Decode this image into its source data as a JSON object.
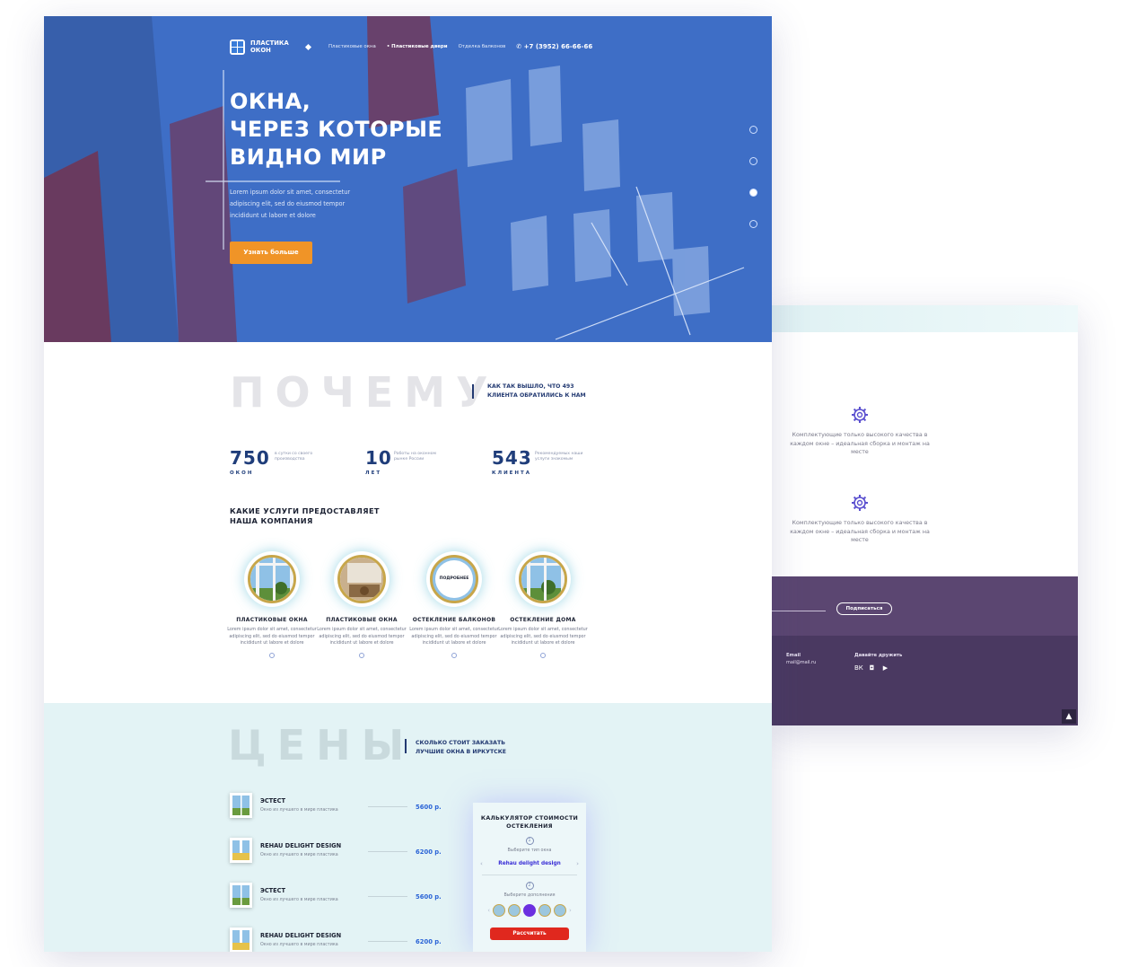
{
  "back_page": {
    "features": [
      {
        "text": "Комплектующие только высокого качества в каждом окне – идеальная сборка и монтаж на месте"
      },
      {
        "text": "Комплектующие только высокого качества в каждом окне – идеальная сборка и монтаж на месте"
      }
    ],
    "subscribe_label": "Подписаться",
    "footer": {
      "email_title": "Email",
      "email_value": "mail@mail.ru",
      "social_title": "Давайте дружить",
      "social_icons": [
        "vk-icon",
        "instagram-icon",
        "youtube-icon"
      ]
    }
  },
  "header": {
    "logo_line1": "ПЛАСТИКА",
    "logo_line2": "ОКОН",
    "nav": [
      "Пластиковые окна",
      "• Пластиковые двери",
      "Отделка балконов"
    ],
    "phone": "+7 (3952) 66-66-66"
  },
  "hero": {
    "title_lines": [
      "ОКНА,",
      "ЧЕРЕЗ КОТОРЫЕ",
      "ВИДНО МИР"
    ],
    "text": "Lorem ipsum dolor sit amet, consectetur adipiscing elit, sed do eiusmod tempor incididunt ut labore et dolore",
    "button": "Узнать больше",
    "slider_active": 3,
    "slider_total": 4
  },
  "why": {
    "heading": "ПОЧЕМУ",
    "subtitle": "КАК ТАК ВЫШЛО, ЧТО 493 КЛИЕНТА ОБРАТИЛИСЬ К НАМ",
    "stats": [
      {
        "number": "750",
        "label": "ОКОН",
        "desc": "в сутки со своего производства"
      },
      {
        "number": "10",
        "label": "ЛЕТ",
        "desc": "Работы на оконном рынке России"
      },
      {
        "number": "543",
        "label": "КЛИЕНТА",
        "desc": "Рекомендуемых наши услуги знакомым"
      }
    ]
  },
  "services": {
    "title": "КАКИЕ УСЛУГИ ПРЕДОСТАВЛЯЕТ НАША КОМПАНИЯ",
    "items": [
      {
        "title": "ПЛАСТИКОВЫЕ ОКНА",
        "text": "Lorem ipsum dolor sit amet, consectetur adipiscing elit, sed do eiusmod tempor incididunt ut labore et dolore"
      },
      {
        "title": "ПЛАСТИКОВЫЕ ОКНА",
        "text": "Lorem ipsum dolor sit amet, consectetur adipiscing elit, sed do eiusmod tempor incididunt ut labore et dolore"
      },
      {
        "title": "ОСТЕКЛЕНИЕ БАЛКОНОВ",
        "text": "Lorem ipsum dolor sit amet, consectetur adipiscing elit, sed do eiusmod tempor incididunt ut labore et dolore",
        "badge": "ПОДРОБНЕЕ"
      },
      {
        "title": "ОСТЕКЛЕНИЕ ДОМА",
        "text": "Lorem ipsum dolor sit amet, consectetur adipiscing elit, sed do eiusmod tempor incididunt ut labore et dolore"
      }
    ]
  },
  "prices": {
    "heading": "ЦЕНЫ",
    "subtitle": "СКОЛЬКО СТОИТ ЗАКАЗАТЬ ЛУЧШИЕ ОКНА В ИРКУТСКЕ",
    "rows": [
      {
        "name": "ЭСТЕСТ",
        "desc": "Окно из лучшего в мире пластика",
        "price": "5600 р."
      },
      {
        "name": "REHAU DELIGHT DESIGN",
        "desc": "Окно из лучшего в мире пластика",
        "price": "6200 р."
      },
      {
        "name": "ЭСТЕСТ",
        "desc": "Окно из лучшего в мире пластика",
        "price": "5600 р."
      },
      {
        "name": "REHAU DELIGHT DESIGN",
        "desc": "Окно из лучшего в мире пластика",
        "price": "6200 р."
      }
    ],
    "calculator": {
      "title": "КАЛЬКУЛЯТОР СТОИМОСТИ ОСТЕКЛЕНИЯ",
      "step1": "1",
      "step1_label": "Выберите тип окна",
      "step1_value": "Rehau delight design",
      "step2": "2",
      "step2_label": "Выберите дополнения",
      "button": "Рассчитать"
    }
  },
  "colors": {
    "hero_blue": "#3f70c8",
    "accent_orange": "#f09427",
    "price_blue": "#2a63d6",
    "calc_red": "#e0281e",
    "footer_purple": "#4a3961"
  }
}
